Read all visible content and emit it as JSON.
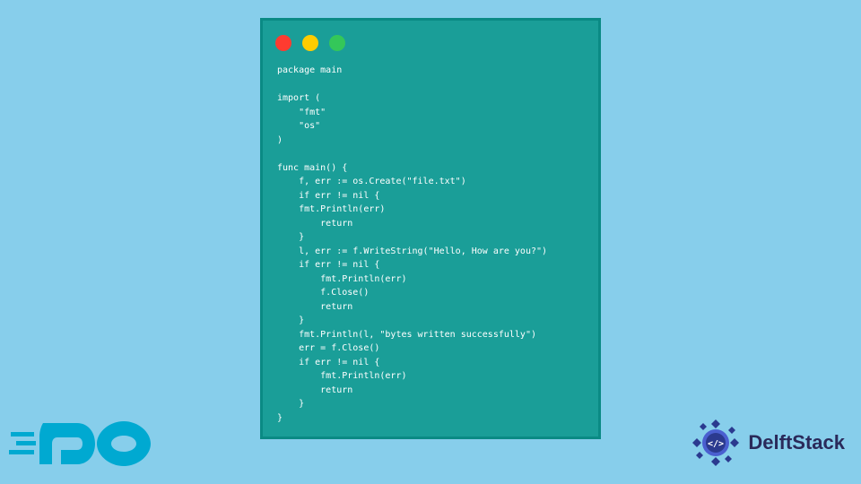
{
  "code": {
    "lines": [
      "package main",
      "",
      "import (",
      "    \"fmt\"",
      "    \"os\"",
      ")",
      "",
      "func main() {",
      "    f, err := os.Create(\"file.txt\")",
      "    if err != nil {",
      "    fmt.Println(err)",
      "        return",
      "    }",
      "    l, err := f.WriteString(\"Hello, How are you?\")",
      "    if err != nil {",
      "        fmt.Println(err)",
      "        f.Close()",
      "        return",
      "    }",
      "    fmt.Println(l, \"bytes written successfully\")",
      "    err = f.Close()",
      "    if err != nil {",
      "        fmt.Println(err)",
      "        return",
      "    }",
      "}"
    ]
  },
  "logos": {
    "go": "GO",
    "delftstack": "DelftStack"
  },
  "colors": {
    "page_bg": "#87ceeb",
    "window_bg": "#1a9e98",
    "window_border": "#0a8a84",
    "code_text": "#ffffff",
    "go_logo": "#00a9d1",
    "delft_primary": "#2b3a8f",
    "delft_accent": "#4a5fd0"
  }
}
